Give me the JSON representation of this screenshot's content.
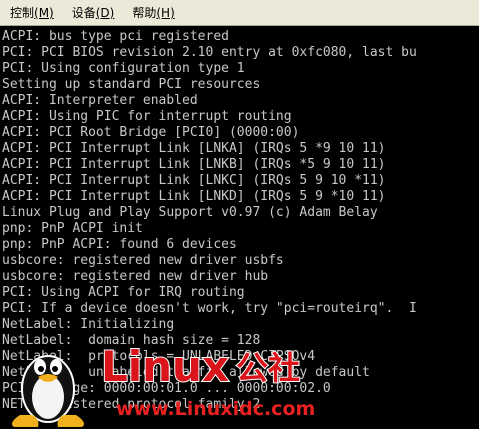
{
  "menubar": {
    "items": [
      {
        "label": "控制",
        "hotkey": "(M)"
      },
      {
        "label": "设备",
        "hotkey": "(D)"
      },
      {
        "label": "帮助",
        "hotkey": "(H)"
      }
    ]
  },
  "console": {
    "lines": [
      "ACPI: bus type pci registered",
      "PCI: PCI BIOS revision 2.10 entry at 0xfc080, last bu",
      "PCI: Using configuration type 1",
      "Setting up standard PCI resources",
      "ACPI: Interpreter enabled",
      "ACPI: Using PIC for interrupt routing",
      "ACPI: PCI Root Bridge [PCI0] (0000:00)",
      "ACPI: PCI Interrupt Link [LNKA] (IRQs 5 *9 10 11)",
      "ACPI: PCI Interrupt Link [LNKB] (IRQs *5 9 10 11)",
      "ACPI: PCI Interrupt Link [LNKC] (IRQs 5 9 10 *11)",
      "ACPI: PCI Interrupt Link [LNKD] (IRQs 5 9 *10 11)",
      "Linux Plug and Play Support v0.97 (c) Adam Belay",
      "pnp: PnP ACPI init",
      "pnp: PnP ACPI: found 6 devices",
      "usbcore: registered new driver usbfs",
      "usbcore: registered new driver hub",
      "PCI: Using ACPI for IRQ routing",
      "PCI: If a device doesn't work, try \"pci=routeirq\".  I",
      "NetLabel: Initializing",
      "NetLabel:  domain hash size = 128",
      "NetLabel:  protocols = UNLABELED CIPSOv4",
      "NetLabel:  unlabeled traffic allowed by default",
      "PCI: Bridge: 0000:00:01.0 ... 0000:00:02.0",
      "NET: Registered protocol family 2"
    ]
  },
  "watermark": {
    "brand": "Linux",
    "suffix": "公社",
    "url": "www.Linuxidc.com"
  },
  "colors": {
    "console_text": "#c8c8c8",
    "console_bg": "#000000",
    "menubar_bg": "#ece9d8",
    "brand_red": "#d9141a",
    "url_red": "#e82020"
  }
}
